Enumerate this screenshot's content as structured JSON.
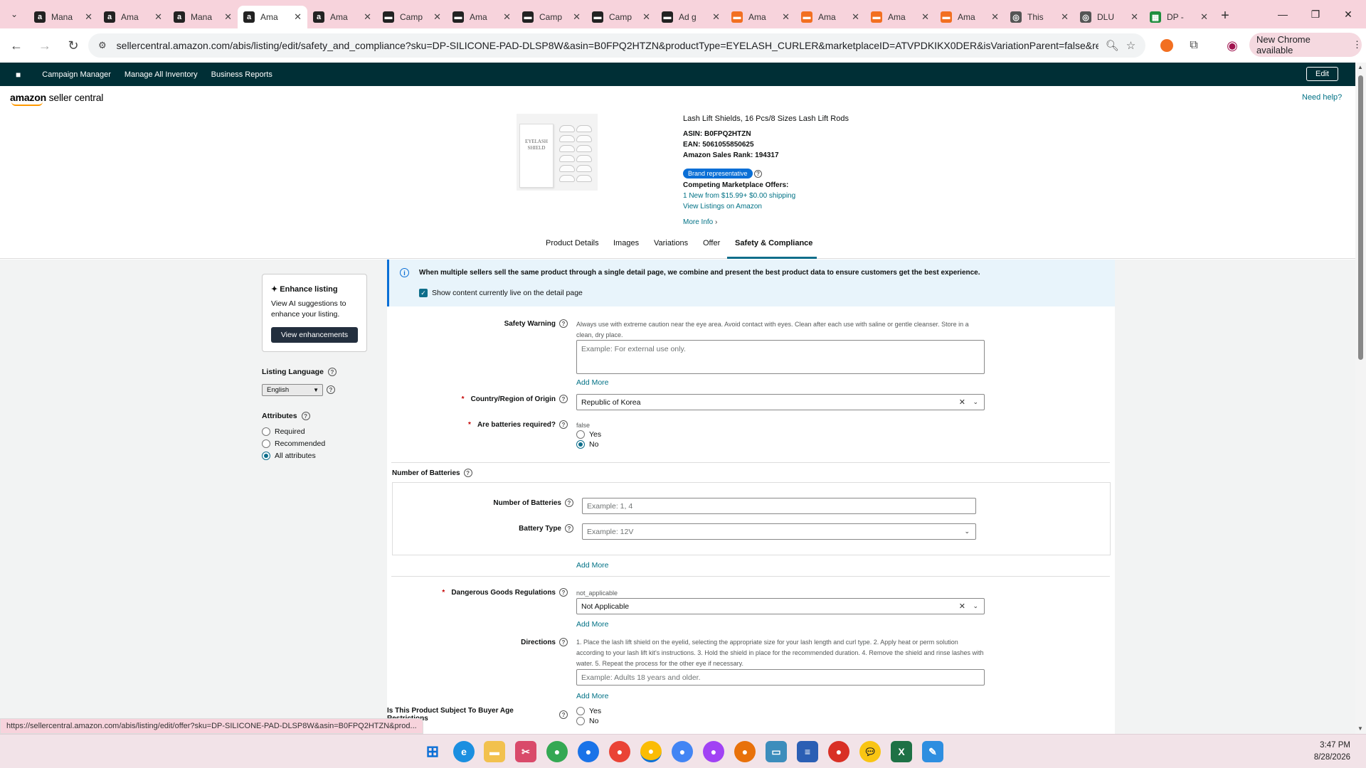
{
  "browser": {
    "tabs": [
      {
        "title": "Mana",
        "icon": "amazon-icon",
        "color": "#222222"
      },
      {
        "title": "Ama",
        "icon": "amazon-icon",
        "color": "#222222"
      },
      {
        "title": "Mana",
        "icon": "amazon-icon",
        "color": "#222222"
      },
      {
        "title": "Ama",
        "icon": "amazon-icon",
        "color": "#222222",
        "active": true
      },
      {
        "title": "Ama",
        "icon": "amazon-icon",
        "color": "#222222"
      },
      {
        "title": "Camp",
        "icon": "campaign-icon",
        "color": "#222222"
      },
      {
        "title": "Ama",
        "icon": "campaign-icon",
        "color": "#222222"
      },
      {
        "title": "Camp",
        "icon": "campaign-icon",
        "color": "#222222"
      },
      {
        "title": "Camp",
        "icon": "campaign-icon",
        "color": "#222222"
      },
      {
        "title": "Ad g",
        "icon": "campaign-icon",
        "color": "#222222"
      },
      {
        "title": "Ama",
        "icon": "orange-icon",
        "color": "#f26f21"
      },
      {
        "title": "Ama",
        "icon": "orange-icon",
        "color": "#f26f21"
      },
      {
        "title": "Ama",
        "icon": "orange-icon",
        "color": "#f26f21"
      },
      {
        "title": "Ama",
        "icon": "orange-icon",
        "color": "#f26f21"
      },
      {
        "title": "This",
        "icon": "globe-icon",
        "color": "#555555"
      },
      {
        "title": "DLU",
        "icon": "globe-icon",
        "color": "#555555"
      },
      {
        "title": "DP -",
        "icon": "sheets-icon",
        "color": "#1e8e3e"
      }
    ],
    "url": "sellercentral.amazon.com/abis/listing/edit/safety_and_compliance?sku=DP-SILICONE-PAD-DLSP8W&asin=B0FPQ2HTZN&productType=EYELASH_CURLER&marketplaceID=ATVPDKIKX0DER&isVariationParent=false&ref_=m...",
    "new_chrome": "New Chrome available",
    "status_url": "https://sellercentral.amazon.com/abis/listing/edit/offer?sku=DP-SILICONE-PAD-DLSP8W&asin=B0FPQ2HTZN&prod..."
  },
  "sc_nav": {
    "links": [
      "Campaign Manager",
      "Manage All Inventory",
      "Business Reports"
    ],
    "edit": "Edit"
  },
  "header": {
    "logo_bold": "amazon",
    "logo_rest": " seller central",
    "need_help": "Need help?"
  },
  "product": {
    "image_text": "EYELASH SHIELD",
    "title": "Lash Lift Shields, 16 Pcs/8 Sizes Lash Lift Rods",
    "asin_label": "ASIN:",
    "asin": "B0FPQ2HTZN",
    "ean_label": "EAN:",
    "ean": "5061055850625",
    "rank_label": "Amazon Sales Rank:",
    "rank": "194317",
    "brand_badge": "Brand representative",
    "competing_label": "Competing Marketplace Offers:",
    "offer": "1 New  from $15.99+ $0.00 shipping",
    "view_listings": "View Listings on Amazon",
    "more_info": "More Info"
  },
  "tabs": [
    "Product Details",
    "Images",
    "Variations",
    "Offer",
    "Safety & Compliance"
  ],
  "sidebar": {
    "enhance_title": "Enhance listing",
    "enhance_text": "View AI suggestions to enhance your listing.",
    "enhance_button": "View enhancements",
    "language_label": "Listing Language",
    "language_value": "English",
    "attributes_label": "Attributes",
    "attributes": [
      {
        "label": "Required",
        "selected": false
      },
      {
        "label": "Recommended",
        "selected": false
      },
      {
        "label": "All attributes",
        "selected": true
      }
    ]
  },
  "banner": {
    "text": "When multiple sellers sell the same product through a single detail page, we combine and present the best product data to ensure customers get the best experience.",
    "checkbox": "Show content currently live on the detail page"
  },
  "form": {
    "safety_warning": {
      "label": "Safety Warning",
      "current": "Always use with extreme caution near the eye area. Avoid contact with eyes. Clean after each use with saline or gentle cleanser. Store in a clean, dry place.",
      "placeholder": "Example: For external use only.",
      "add_more": "Add More"
    },
    "country": {
      "label": "Country/Region of Origin",
      "value": "Republic of Korea"
    },
    "batteries": {
      "label": "Are batteries required?",
      "current": "false",
      "options": [
        "Yes",
        "No"
      ],
      "selected": "No"
    },
    "num_batteries_group": {
      "label": "Number of Batteries",
      "count_label": "Number of Batteries",
      "count_placeholder": "Example: 1, 4",
      "type_label": "Battery Type",
      "type_placeholder": "Example: 12V",
      "add_more": "Add More"
    },
    "dangerous_goods": {
      "label": "Dangerous Goods Regulations",
      "current": "not_applicable",
      "value": "Not Applicable",
      "add_more": "Add More"
    },
    "directions": {
      "label": "Directions",
      "current": "1. Place the lash lift shield on the eyelid, selecting the appropriate size for your lash length and curl type. 2. Apply heat or perm solution according to your lash lift kit's instructions. 3. Hold the shield in place for the recommended duration. 4. Remove the shield and rinse lashes with water. 5. Repeat the process for the other eye if necessary.",
      "placeholder": "Example: Adults 18 years and older.",
      "add_more": "Add More"
    },
    "age_restriction": {
      "label": "Is This Product Subject To Buyer Age Restrictions",
      "options": [
        "Yes",
        "No"
      ]
    }
  },
  "taskbar": {
    "time": "3:47 PM",
    "date": "8/28/2026"
  }
}
